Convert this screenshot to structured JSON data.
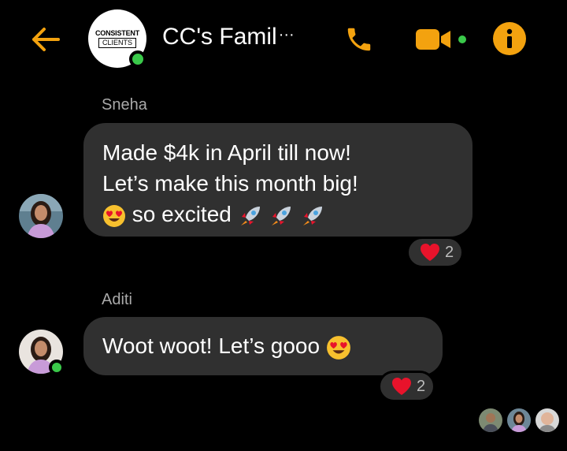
{
  "header": {
    "back_icon": "arrow-left-icon",
    "group_logo_line1": "CONSISTENT",
    "group_logo_line2": "CLIENTS",
    "title": "CC's Famil",
    "title_ellipsis": "···",
    "call_icon": "phone-icon",
    "video_icon": "video-camera-icon",
    "info_icon": "info-icon",
    "accent_color": "#f3a20f",
    "online_color": "#3ac94a"
  },
  "messages": [
    {
      "sender": "Sneha",
      "lines": [
        "Made $4k in April till now!",
        "Let’s make this month big!",
        "so excited"
      ],
      "emojis": [
        "heart-eyes-emoji",
        "rocket-emoji",
        "rocket-emoji",
        "rocket-emoji"
      ],
      "reaction": {
        "icon": "red-heart-icon",
        "count": "2"
      }
    },
    {
      "sender": "Aditi",
      "lines": [
        "Woot woot! Let’s gooo"
      ],
      "emojis": [
        "heart-eyes-emoji"
      ],
      "reaction": {
        "icon": "red-heart-icon",
        "count": "2"
      }
    }
  ],
  "read_receipts": [
    "avatar-man-outdoors",
    "avatar-woman",
    "avatar-bald-man"
  ],
  "colors": {
    "background": "#000000",
    "bubble": "#303030",
    "heart": "#e8132b"
  }
}
